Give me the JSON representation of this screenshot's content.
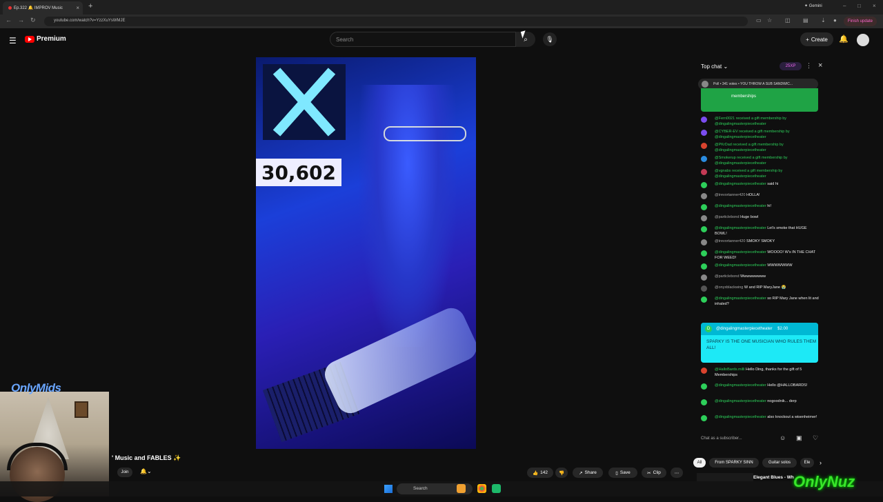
{
  "browser": {
    "tab_title": "Ep.322 🔔 IMPROV Music",
    "new_tab": "+",
    "gemini": "✦ Gemini",
    "url": "youtube.com/watch?v=YzzXuYsWMJE",
    "finish_update": "Finish update"
  },
  "youtube": {
    "brand": "Premium",
    "search_placeholder": "Search",
    "create_label": "Create"
  },
  "video": {
    "counter": "30,602",
    "title": "' Music and FABLES ✨",
    "join_label": "Join",
    "likes": "142",
    "share_label": "Share",
    "save_label": "Save",
    "clip_label": "Clip"
  },
  "chat": {
    "header": "Top chat",
    "xp_badge": "25XP",
    "poll_text": "Poll • 341 votes • YOU THROW A SUB SANDWIC...",
    "membership_banner": "memberships",
    "messages": [
      {
        "name": "@Fern0021",
        "text": "received a gift membership by @dingalingmasterpiecetheater",
        "color": "#7b4df0",
        "gift": true
      },
      {
        "name": "@CYBER-EV",
        "text": "received a gift membership by @dingalingmasterpiecetheater",
        "color": "#7b4df0",
        "gift": true
      },
      {
        "name": "@PKrDad",
        "text": "received a gift membership by @dingalingmasterpiecetheater",
        "color": "#d9432e",
        "gift": true
      },
      {
        "name": "@Smokerup",
        "text": "received a gift membership by @dingalingmasterpiecetheater",
        "color": "#2b8ce0",
        "gift": true
      },
      {
        "name": "@vgnabs",
        "text": "received a gift membership by @dingalingmasterpiecetheater",
        "color": "#c43a55",
        "gift": true
      },
      {
        "name": "@dingalingmasterpiecetheater",
        "text": "said hi",
        "color": "#2dcf5a"
      },
      {
        "name": "@trevortanner420",
        "text": "HOLLA!",
        "color": "#888",
        "gray": true
      },
      {
        "name": "@dingalingmasterpiecetheater",
        "text": "hi!",
        "color": "#2dcf5a"
      },
      {
        "name": "@particlebond",
        "text": "Huge bowl",
        "color": "#888",
        "gray": true
      },
      {
        "name": "@dingalingmasterpiecetheater",
        "text": "Let's smoke that HUGE BOWL!",
        "color": "#2dcf5a"
      },
      {
        "name": "@trevortanner420",
        "text": "SMOKY SMOKY",
        "color": "#888",
        "gray": true
      },
      {
        "name": "@dingalingmasterpiecetheater",
        "text": "WOOOO! W's IN THE CHAT FOR WEED!",
        "color": "#2dcf5a"
      },
      {
        "name": "@dingalingmasterpiecetheater",
        "text": "WWWWWWW",
        "color": "#2dcf5a"
      },
      {
        "name": "@particlebond",
        "text": "Wwwwwwwww",
        "color": "#888",
        "gray": true
      },
      {
        "name": "@onyxblackwing",
        "text": "W and RIP MaryJane 😭",
        "color": "#555",
        "gray": true
      },
      {
        "name": "@dingalingmasterpiecetheater",
        "text": "so RIP Mary Jane when lit and inhaled?",
        "color": "#2dcf5a"
      }
    ],
    "superchat": {
      "name": "@dingalingmasterpiecetheater",
      "amount": "$2.00",
      "text": "SPARKY IS THE ONE MUSICIAN WHO RULES THEM ALL!",
      "avatar_letter": "D"
    },
    "messages_after": [
      {
        "name": "@HalloBards.milli",
        "text": "Hello Ding, thanks for the gift of 5 Memberships",
        "color": "#d9432e"
      },
      {
        "name": "@dingalingmasterpiecetheater",
        "text": "Hello @HALLOBARDS!",
        "color": "#2dcf5a"
      },
      {
        "name": "@dingalingmasterpiecetheater",
        "text": "nogoodnik... derp",
        "color": "#2dcf5a"
      },
      {
        "name": "@dingalingmasterpiecetheater",
        "text": "also knockout a wisenheimer!",
        "color": "#2dcf5a"
      }
    ],
    "input_placeholder": "Chat as a subscriber..."
  },
  "chips": [
    "All",
    "From SPARKY SINN",
    "Guitar solos",
    "Ele"
  ],
  "recommendation": "Elegant Blues - Wh",
  "watermarks": {
    "left": "OnlyMids",
    "right": "OnlyNuz"
  },
  "taskbar": {
    "search": "Search"
  }
}
